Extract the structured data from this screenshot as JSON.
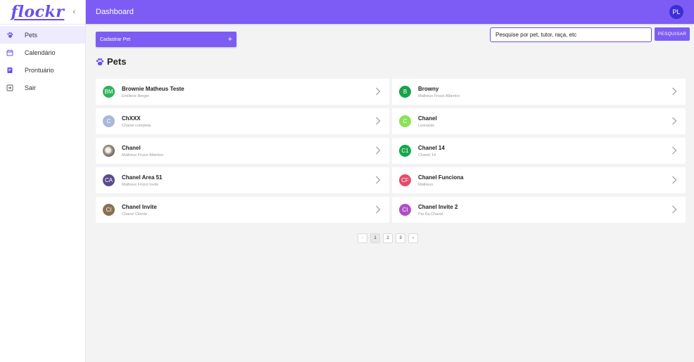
{
  "app": {
    "logo": "flockr",
    "header_title": "Dashboard",
    "user_initials": "PL"
  },
  "sidebar": {
    "collapse_glyph": "‹",
    "items": [
      {
        "label": "Pets",
        "icon": "paw-icon",
        "active": true
      },
      {
        "label": "Calendário",
        "icon": "calendar-icon",
        "active": false
      },
      {
        "label": "Prontuário",
        "icon": "record-icon",
        "active": false
      },
      {
        "label": "Sair",
        "icon": "logout-icon",
        "active": false
      }
    ]
  },
  "toolbar": {
    "create_label": "Cadastrar Pet",
    "create_plus": "+",
    "search_value": "Pesquise por pet, tutor, raça, etc",
    "search_button": "PESQUISAR"
  },
  "section": {
    "title": "Pets"
  },
  "pets": [
    {
      "initials": "BM",
      "name": "Brownie Matheus Teste",
      "owner": "Emiliene Berger",
      "color": "#2db45a"
    },
    {
      "initials": "B",
      "name": "Browny",
      "owner": "Matheus Frozzi Alberton",
      "color": "#17a34a"
    },
    {
      "initials": "C",
      "name": "ChXXX",
      "owner": "Chanel completa",
      "color": "#a9b8d8"
    },
    {
      "initials": "C",
      "name": "Chanel",
      "owner": "Leonardo",
      "color": "#8de05a"
    },
    {
      "initials": "",
      "name": "Chanel",
      "owner": "Matheus Frozzi Alberton",
      "color": "photo"
    },
    {
      "initials": "C1",
      "name": "Chanel 14",
      "owner": "Chanel 14",
      "color": "#14a84a"
    },
    {
      "initials": "CA",
      "name": "Chanel Area 51",
      "owner": "Matheus Frozzi Invite",
      "color": "#5b4a8c"
    },
    {
      "initials": "CF",
      "name": "Chanel Funciona",
      "owner": "Matheus",
      "color": "#e8486a"
    },
    {
      "initials": "CI",
      "name": "Chanel Invite",
      "owner": "Chanel Cliente",
      "color": "#8a7050"
    },
    {
      "initials": "CI",
      "name": "Chanel Invite 2",
      "owner": "Pai Da Chanel",
      "color": "#b04ec4"
    }
  ],
  "pagination": {
    "prev": "‹",
    "pages": [
      "1",
      "2",
      "3"
    ],
    "current": "1",
    "next": "›"
  }
}
